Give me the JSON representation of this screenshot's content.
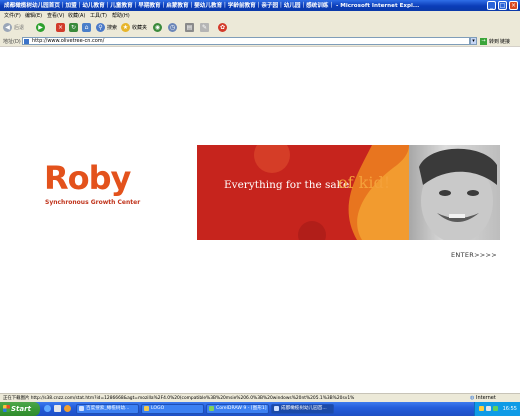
{
  "window": {
    "title": "成都橄榄树幼儿园首页｜加盟｜幼儿教育｜儿童教育｜早期教育｜启蒙教育｜婴幼儿教育｜学龄前教育｜亲子园｜幼儿园｜感统训练｜ - Microsoft Internet Expl..."
  },
  "menubar": {
    "items": [
      "文件(F)",
      "编辑(E)",
      "查看(V)",
      "收藏(A)",
      "工具(T)",
      "帮助(H)"
    ]
  },
  "toolbar": {
    "back": "后退",
    "search": "搜索",
    "favorites": "收藏夹"
  },
  "address": {
    "label": "地址(D)",
    "url": "http://www.olivetree-cn.com/",
    "go": "转到",
    "links": "链接"
  },
  "page": {
    "logo_word": "Roby",
    "logo_tagline": "Synchronous Growth Center",
    "banner_tagline": "Everything for the sake",
    "banner_kid": "of kid!",
    "enter": "ENTER>>>>"
  },
  "status": {
    "text": "正在下载图片 http://s38.cnzz.com/stat.htm?id=1286668&agt=mozilla%2F4.0%20(compatible%3B%20msie%206.0%3B%20windows%20nt%205.1%3B%20sv1%",
    "zone": "Internet"
  },
  "taskbar": {
    "start": "Start",
    "tasks": [
      "百度搜索_橄榄树幼...",
      "LOGO",
      "CorelDRAW 9 - [图形1]",
      "成都橄榄树幼儿园首..."
    ],
    "clock": "16:55"
  },
  "colors": {
    "brand_orange": "#e3521c",
    "banner_red": "#c6241d",
    "xp_blue": "#245ddb"
  }
}
